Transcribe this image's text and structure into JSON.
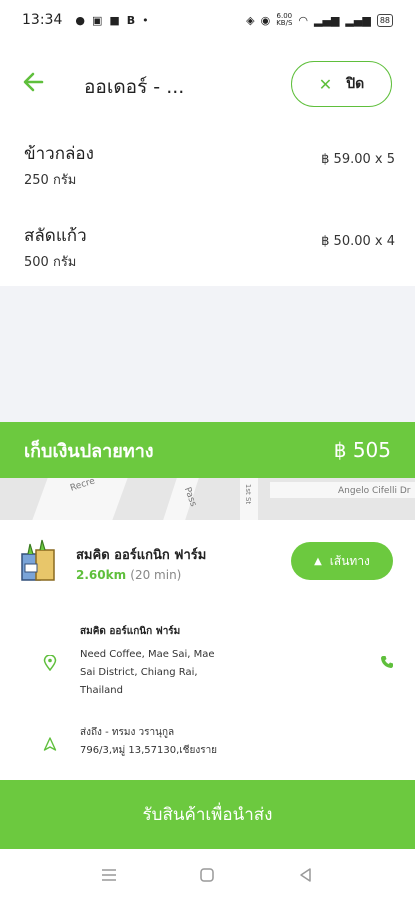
{
  "status_bar": {
    "time": "13:34",
    "left_icons": [
      "chat-icon",
      "image-icon",
      "bag-icon",
      "b-icon",
      "dot-icon"
    ],
    "right_icons": [
      "vibrate-icon",
      "location-icon",
      "speed-icon",
      "wifi-icon",
      "signal-icon",
      "signal-icon",
      "battery-icon"
    ],
    "speed_label": "6.00\nKB/S",
    "battery": "88"
  },
  "header": {
    "title": "ออเดอร์ - ...",
    "close_label": "ปิด"
  },
  "items": [
    {
      "name": "ข้าวกล่อง",
      "weight": "250 กรัม",
      "price": "฿ 59.00 x 5"
    },
    {
      "name": "สลัดแก้ว",
      "weight": "500 กรัม",
      "price": "฿ 50.00 x 4"
    }
  ],
  "cod": {
    "label": "เก็บเงินปลายทาง",
    "amount": "฿ 505"
  },
  "map": {
    "labels": [
      "Recre",
      "Pass",
      "1st St",
      "Angelo Cifelli Dr"
    ]
  },
  "store": {
    "name": "สมคิด ออร์แกนิก ฟาร์ม",
    "distance": "2.60km",
    "duration": "(20 min)",
    "route_label": "เส้นทาง"
  },
  "pickup": {
    "name": "สมคิด ออร์แกนิก ฟาร์ม",
    "address_lines": [
      "Need Coffee, Mae Sai, Mae",
      "Sai District, Chiang Rai,",
      "Thailand"
    ]
  },
  "recipient": {
    "lines": [
      "ส่งถึง - ทรมง วรานุกูล",
      "796/3,หมู่ 13,57130,เชียงราย"
    ]
  },
  "cta": {
    "label": "รับสินค้าเพื่อนำส่ง"
  },
  "colors": {
    "accent": "#6cc93f",
    "accent_dark": "#5fbf3c",
    "background": "#f2f3f7"
  }
}
